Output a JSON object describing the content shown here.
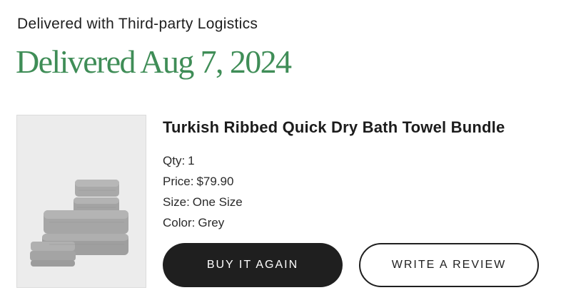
{
  "shipping": {
    "method_text": "Delivered with Third-party Logistics",
    "status_text": "Delivered Aug 7, 2024",
    "status_color": "#3f8d57"
  },
  "product": {
    "image_icon": "towel-stack-image",
    "title": "Turkish Ribbed Quick Dry Bath Towel Bundle",
    "details": {
      "qty_label": "Qty:",
      "qty_value": "1",
      "price_label": "Price:",
      "price_value": "$79.90",
      "size_label": "Size:",
      "size_value": "One Size",
      "color_label": "Color:",
      "color_value": "Grey"
    }
  },
  "actions": {
    "buy_again_label": "BUY IT AGAIN",
    "write_review_label": "WRITE A REVIEW"
  }
}
